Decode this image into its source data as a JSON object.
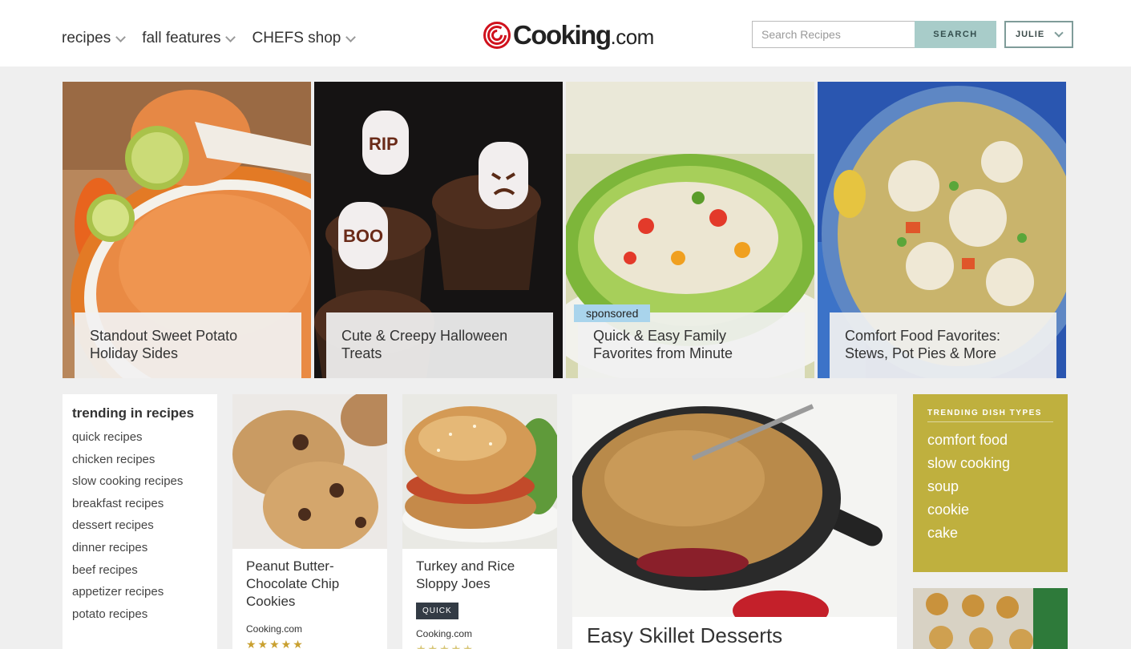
{
  "header": {
    "nav": [
      "recipes",
      "fall features",
      "CHEFS shop"
    ],
    "logo": {
      "name": "Cooking",
      "suffix": ".com"
    },
    "search_placeholder": "Search Recipes",
    "search_button": "SEARCH",
    "user_menu": "JULIE"
  },
  "hero": [
    {
      "caption": "Standout Sweet Potato Holiday Sides"
    },
    {
      "caption": "Cute & Creepy Halloween Treats",
      "marshmallow_1": "RIP",
      "marshmallow_2": "BOO"
    },
    {
      "caption": "Quick & Easy Family Favorites from Minute",
      "badge": "sponsored"
    },
    {
      "caption": "Comfort Food Favorites: Stews, Pot Pies & More"
    }
  ],
  "trending": {
    "title": "trending in recipes",
    "items": [
      "quick recipes",
      "chicken recipes",
      "slow cooking recipes",
      "breakfast recipes",
      "dessert recipes",
      "dinner recipes",
      "beef recipes",
      "appetizer recipes",
      "potato recipes"
    ]
  },
  "cards": [
    {
      "title": "Peanut Butter-Chocolate Chip Cookies",
      "source": "Cooking.com",
      "stars": "★★★★★"
    },
    {
      "title": "Turkey and Rice Sloppy Joes",
      "tag": "QUICK",
      "source": "Cooking.com",
      "stars": "★★★★★"
    }
  ],
  "feature": {
    "title": "Easy Skillet Desserts"
  },
  "dish_types": {
    "title": "TRENDING DISH TYPES",
    "items": [
      "comfort food",
      "slow cooking",
      "soup",
      "cookie",
      "cake"
    ]
  },
  "colors": {
    "accent": "#a8ccc9",
    "dish_types_bg": "#bfb03e",
    "logo_red": "#d0121d"
  }
}
